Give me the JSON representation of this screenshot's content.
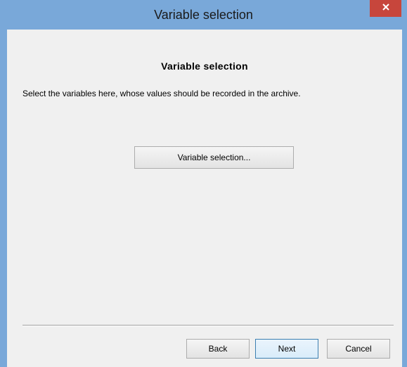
{
  "window": {
    "title": "Variable selection",
    "close_icon": "close-icon"
  },
  "page": {
    "heading": "Variable selection",
    "description": "Select the variables here, whose values should be recorded in the archive.",
    "variable_selection_button": "Variable selection..."
  },
  "footer": {
    "back_label": "Back",
    "next_label": "Next",
    "cancel_label": "Cancel"
  },
  "colors": {
    "titlebar": "#79a8d9",
    "close_button": "#c7463c",
    "client_background": "#f0f0f0",
    "default_button_border": "#3c7fb1"
  }
}
